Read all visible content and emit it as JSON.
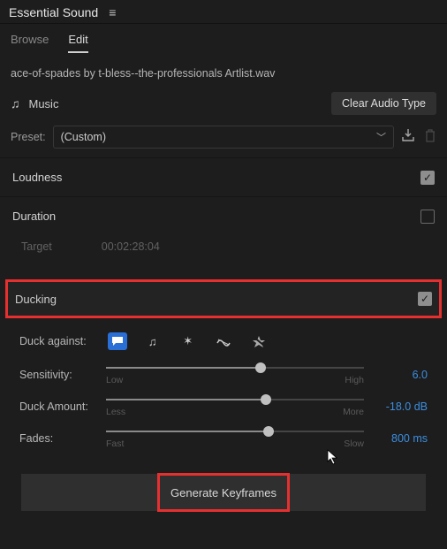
{
  "panel": {
    "title": "Essential Sound"
  },
  "tabs": {
    "browse": "Browse",
    "edit": "Edit"
  },
  "clip": {
    "name": "ace-of-spades by t-bless--the-professionals Artlist.wav",
    "type": "Music",
    "clear_btn": "Clear Audio Type"
  },
  "preset": {
    "label": "Preset:",
    "value": "(Custom)"
  },
  "sections": {
    "loudness": {
      "label": "Loudness",
      "enabled": true
    },
    "duration": {
      "label": "Duration",
      "enabled": false,
      "target_label": "Target",
      "target_value": "00:02:28:04"
    },
    "ducking": {
      "label": "Ducking",
      "enabled": true
    }
  },
  "ducking": {
    "against_label": "Duck against:",
    "sensitivity": {
      "label": "Sensitivity:",
      "min": "Low",
      "max": "High",
      "value": "6.0",
      "pct": 60
    },
    "amount": {
      "label": "Duck Amount:",
      "min": "Less",
      "max": "More",
      "value": "-18.0 dB",
      "pct": 62
    },
    "fades": {
      "label": "Fades:",
      "min": "Fast",
      "max": "Slow",
      "value": "800 ms",
      "pct": 63
    }
  },
  "buttons": {
    "generate": "Generate Keyframes"
  }
}
